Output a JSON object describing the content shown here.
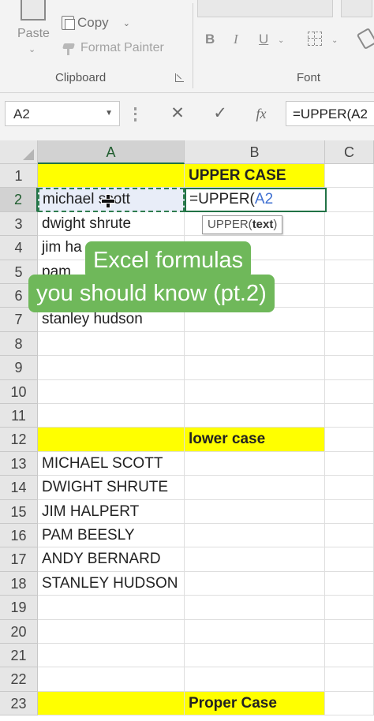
{
  "ribbon": {
    "paste_label": "Paste",
    "copy_label": "Copy",
    "format_painter_label": "Format Painter",
    "clipboard_group_label": "Clipboard",
    "font_group_label": "Font",
    "bold_label": "B",
    "italic_label": "I",
    "underline_label": "U"
  },
  "formula_bar": {
    "name_box": "A2",
    "formula": "=UPPER(A2"
  },
  "columns": [
    "A",
    "B",
    "C"
  ],
  "rows": [
    "1",
    "2",
    "3",
    "4",
    "5",
    "6",
    "7",
    "8",
    "9",
    "10",
    "11",
    "12",
    "13",
    "14",
    "15",
    "16",
    "17",
    "18",
    "19",
    "20",
    "21",
    "22",
    "23"
  ],
  "cells": {
    "b1": "UPPER CASE",
    "a2": "michael scott",
    "b2_prefix": "=UPPER(",
    "b2_ref": "A2",
    "a3": "dwight shrute",
    "a4": "jim ha",
    "a5": "pam",
    "a7": "stanley hudson",
    "b12": "lower case",
    "a13": "MICHAEL SCOTT",
    "a14": "DWIGHT SHRUTE",
    "a15": "JIM HALPERT",
    "a16": "PAM BEESLY",
    "a17": "ANDY BERNARD",
    "a18": "STANLEY HUDSON",
    "b23": "Proper Case"
  },
  "tooltip": {
    "func": "UPPER(",
    "arg": "text",
    "close": ")"
  },
  "caption": {
    "line1": "Excel formulas",
    "line2": "you should know (pt.2)"
  },
  "colors": {
    "highlight_yellow": "#ffff00",
    "excel_green": "#217346",
    "caption_green": "#6fb85a"
  }
}
